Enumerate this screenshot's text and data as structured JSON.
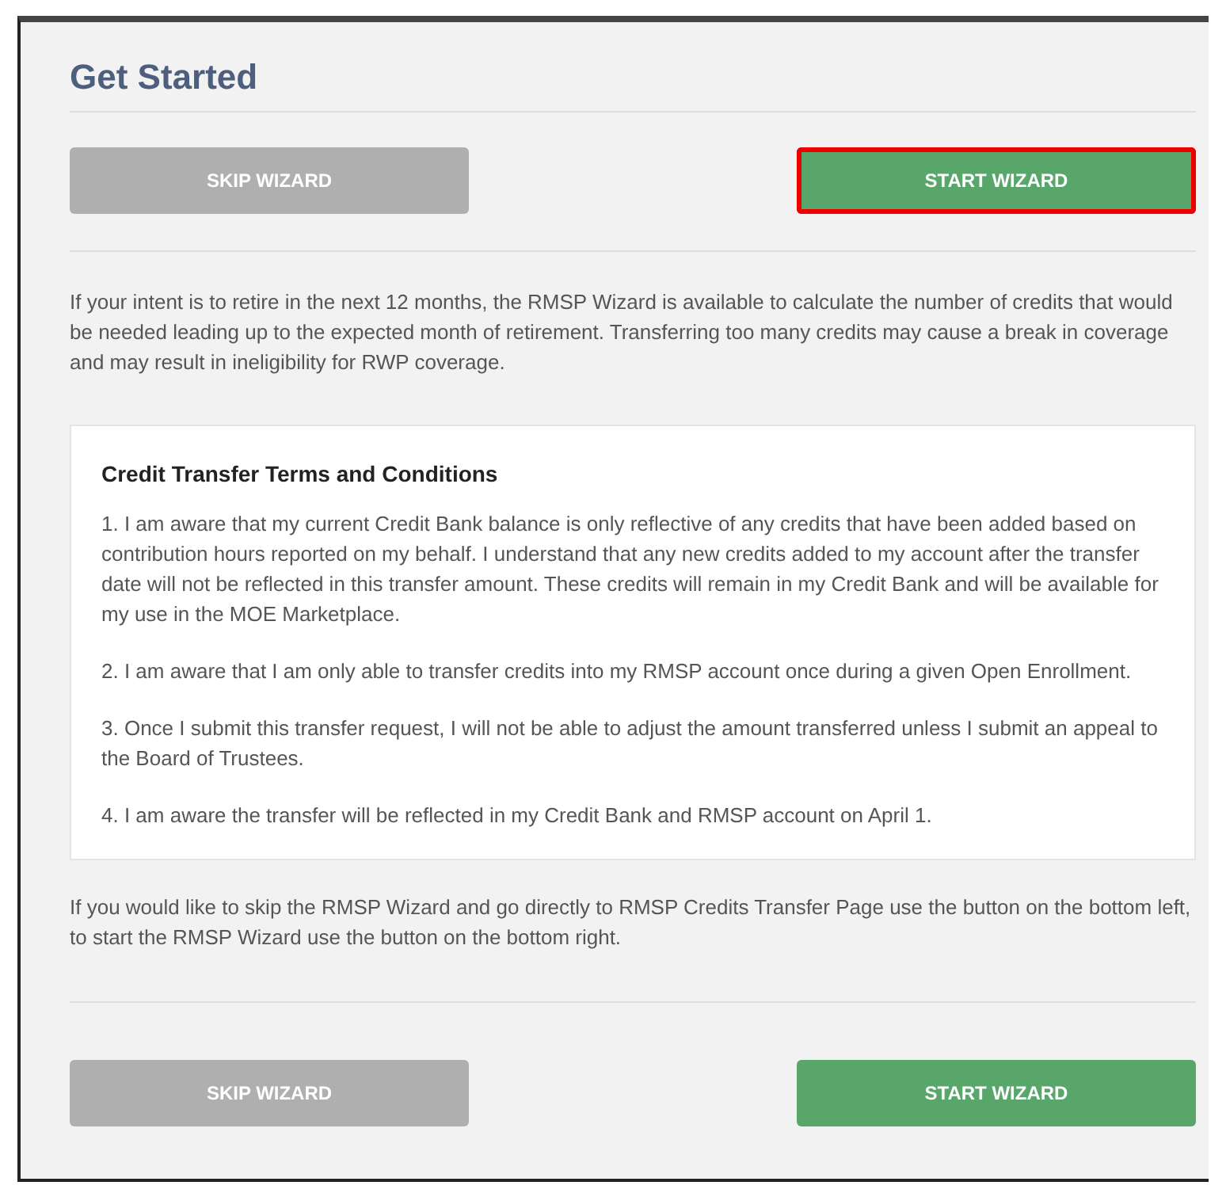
{
  "title": "Get Started",
  "top_buttons": [
    {
      "label": "SKIP WIZARD",
      "kind": "secondary",
      "highlighted": false
    },
    {
      "label": "START WIZARD",
      "kind": "primary",
      "highlighted": true
    }
  ],
  "intro": "If your intent is to retire in the next 12 months, the RMSP Wizard is available to calculate the number of credits that would be needed leading up to the expected month of retirement. Transferring too many credits may cause a break in coverage and may result in ineligibility for RWP coverage.",
  "terms": {
    "title": "Credit Transfer Terms and Conditions",
    "items": [
      "1. I am aware that my current Credit Bank balance is only reflective of any credits that have been added based on contribution hours reported on my behalf. I understand that any new credits added to my account after the transfer date will not be reflected in this transfer amount. These credits will remain in my Credit Bank and will be available for my use in the MOE Marketplace.",
      "2. I am aware that I am only able to transfer credits into my RMSP account once during a given Open Enrollment.",
      "3. Once I submit this transfer request, I will not be able to adjust the amount transferred unless I submit an appeal to the Board of Trustees.",
      "4. I am aware the transfer will be reflected in my Credit Bank and RMSP account on April 1."
    ]
  },
  "outro": "If you would like to skip the RMSP Wizard and go directly to RMSP Credits Transfer Page use the button on the bottom left, to start the RMSP Wizard use the button on the bottom right.",
  "bottom_buttons": [
    {
      "label": "SKIP WIZARD",
      "kind": "secondary",
      "highlighted": false
    },
    {
      "label": "START WIZARD",
      "kind": "primary",
      "highlighted": false
    }
  ]
}
